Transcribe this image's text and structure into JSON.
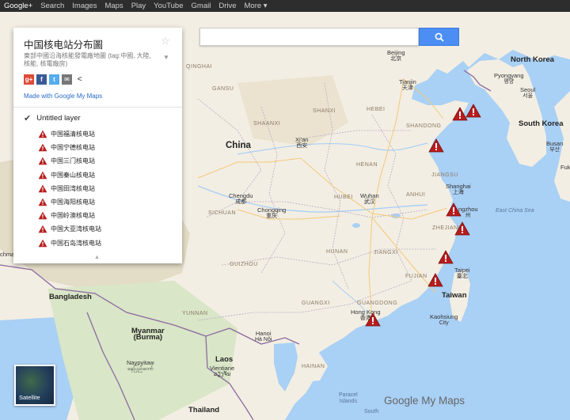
{
  "topbar": [
    "Google+",
    "Search",
    "Images",
    "Maps",
    "Play",
    "YouTube",
    "Gmail",
    "Drive",
    "More ▾"
  ],
  "panel": {
    "title": "中国核电站分布圖",
    "description": "東部中國沿海核能發電廠地圖 (tag:中國, 大陸, 核能, 核電廠房)",
    "made_with": "Made with Google My Maps",
    "layer_name": "Untitled layer",
    "items": [
      "中国福清核电站",
      "中国宁德核电站",
      "中国三门核电站",
      "中国秦山核电站",
      "中国田湾核电站",
      "中国海阳核电站",
      "中国岭澳核电站",
      "中国大亚湾核电站",
      "中国石岛湾核电站"
    ]
  },
  "search": {
    "placeholder": "",
    "value": ""
  },
  "satellite_label": "Satellite",
  "logo": "Google My Maps",
  "map_labels": {
    "gansu": "GANSU",
    "shaanxi": "SHAANXI",
    "shanxi": "SHANXI",
    "hebei": "HEBEI",
    "shandong": "SHANDONG",
    "henan": "HENAN",
    "jiangsu": "JIANGSU",
    "anhui": "ANHUI",
    "hubei": "HUBEI",
    "sichuan": "SICHUAN",
    "hunan": "HUNAN",
    "jiangxi": "JIANGXI",
    "zhejiang": "ZHEJIANG",
    "fujian": "FUJIAN",
    "guangxi": "GUANGXI",
    "guangdong": "GUANGDONG",
    "yunnan": "YUNNAN",
    "guizhou": "GUIZHOU",
    "qinghai": "QINGHAI",
    "hainan": "HAINAN",
    "china": "China",
    "north_korea": "North Korea",
    "south_korea": "South Korea",
    "bangladesh": "Bangladesh",
    "myanmar": "Myanmar",
    "burma": "(Burma)",
    "laos": "Laos",
    "thailand": "Thailand",
    "taiwan": "Taiwan",
    "east_china_sea": "East China Sea",
    "beijing": "Beijing",
    "beijing_cn": "北京",
    "tianjin": "Tianjin",
    "tianjin_cn": "天津",
    "pyongyang": "Pyongyang",
    "pyongyang_cn": "평양",
    "seoul": "Seoul",
    "seoul_cn": "서울",
    "busan": "Busan",
    "busan_cn": "부산",
    "fuk": "Fuk",
    "xian": "Xi'an",
    "xian_cn": "西安",
    "chengdu": "Chengdu",
    "chengdu_cn": "成都",
    "chongqing": "Chongqing",
    "chongqing_cn": "重庆",
    "wuhan": "Wuhan",
    "wuhan_cn": "武汉",
    "shanghai": "Shanghai",
    "shanghai_cn": "上海",
    "hangzhou": "ngzhou",
    "hangzhou_cn": "州",
    "taipei": "Taipei",
    "taipei_cn": "臺北",
    "kaohsiung": "Kaohsiung",
    "kaohsiung_city": "City",
    "hong_kong": "Hong Kong",
    "hong_kong_cn": "香港",
    "hanoi": "Hanoi",
    "hanoi_cn": "Hà Nội",
    "vientiane": "Vientiane",
    "vientiane_cn": "ວຽງຈັນ",
    "naypyitaw": "Naypyitaw",
    "naypyitaw_cn": "နေပြည်တော်",
    "chma": "chma",
    "paracel": "Paracel",
    "paracel2": "Islands",
    "south": "South"
  }
}
